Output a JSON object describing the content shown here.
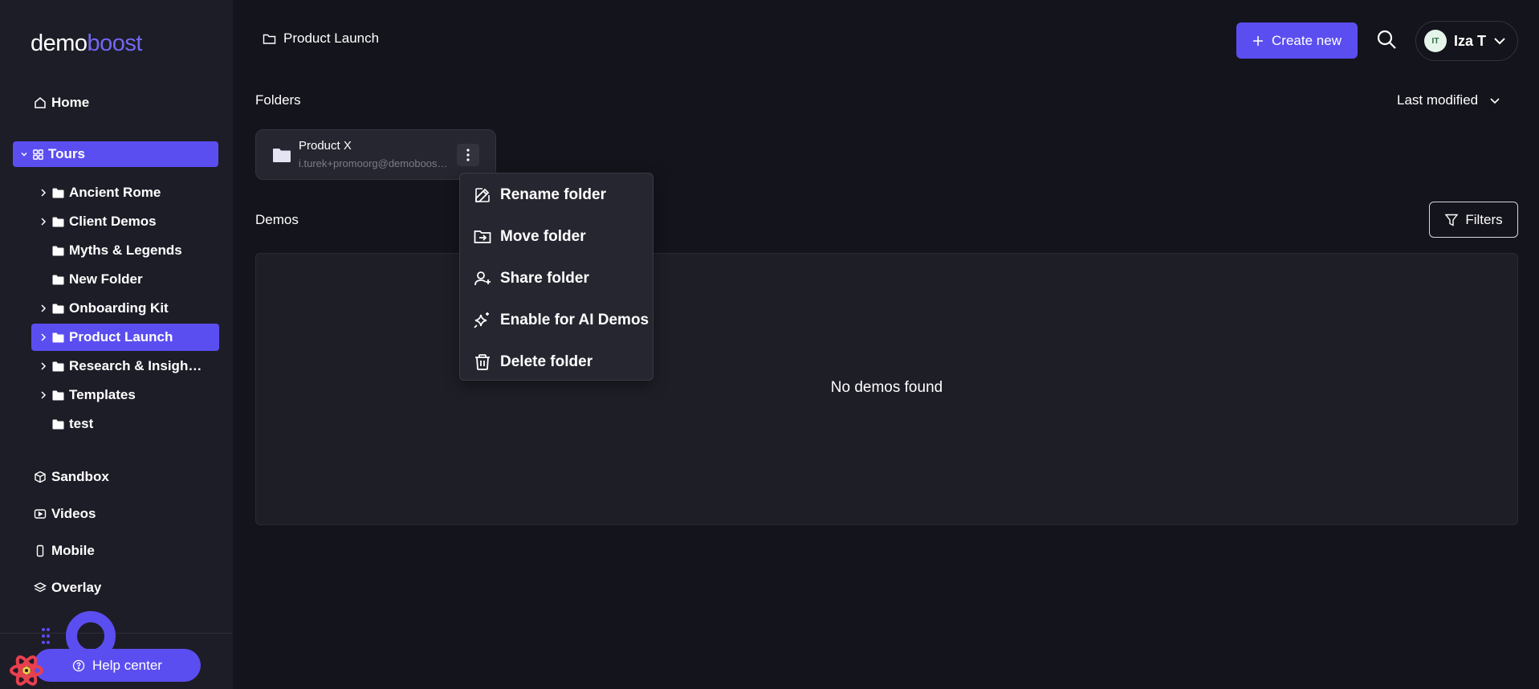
{
  "brand": {
    "part1": "demo",
    "part2": "boost"
  },
  "sidebar": {
    "home": "Home",
    "tours": "Tours",
    "tree": [
      {
        "label": "Ancient Rome",
        "expandable": true,
        "active": false
      },
      {
        "label": "Client Demos",
        "expandable": true,
        "active": false
      },
      {
        "label": "Myths & Legends",
        "expandable": false,
        "active": false
      },
      {
        "label": "New Folder",
        "expandable": false,
        "active": false
      },
      {
        "label": "Onboarding Kit",
        "expandable": true,
        "active": false
      },
      {
        "label": "Product Launch",
        "expandable": true,
        "active": true
      },
      {
        "label": "Research & Insigh…",
        "expandable": true,
        "active": false
      },
      {
        "label": "Templates",
        "expandable": true,
        "active": false
      },
      {
        "label": "test",
        "expandable": false,
        "active": false
      }
    ],
    "sandbox": "Sandbox",
    "videos": "Videos",
    "mobile": "Mobile",
    "overlay": "Overlay",
    "help": "Help center"
  },
  "header": {
    "breadcrumb": "Product Launch",
    "create_label": "Create new",
    "user_initials": "IT",
    "user_name": "Iza T"
  },
  "folders_section": {
    "title": "Folders",
    "sort_label": "Last modified",
    "folders": [
      {
        "name": "Product X",
        "owner": "i.turek+promoorg@demoboost.com"
      }
    ]
  },
  "context_menu": {
    "items": [
      {
        "label": "Rename folder",
        "icon": "pencil-icon"
      },
      {
        "label": "Move folder",
        "icon": "folder-move-icon"
      },
      {
        "label": "Share folder",
        "icon": "user-plus-icon"
      },
      {
        "label": "Enable for AI Demos",
        "icon": "sparkles-icon"
      },
      {
        "label": "Delete folder",
        "icon": "trash-icon"
      }
    ]
  },
  "demos_section": {
    "title": "Demos",
    "filters_label": "Filters",
    "empty_text": "No demos found"
  },
  "colors": {
    "accent": "#5b4ef0",
    "brand_accent": "#7367f0",
    "background": "#14141c",
    "sidebar": "#1d1d27"
  }
}
